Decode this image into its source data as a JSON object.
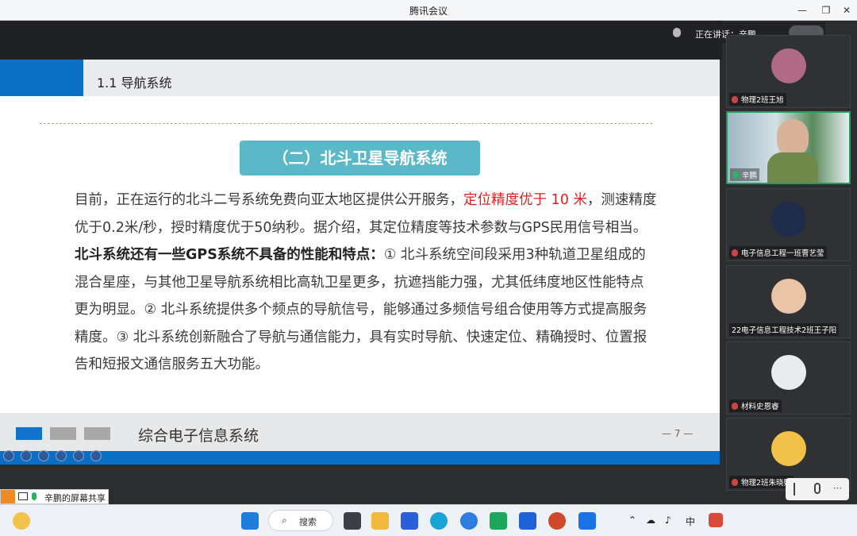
{
  "app": {
    "title": "腾讯会议"
  },
  "speaker": {
    "label": "正在讲话：辛鹏"
  },
  "slide": {
    "section_title": "1.1 导航系统",
    "badge": "（二）北斗卫星导航系统",
    "p1_a": "目前，正在运行的北斗二号系统免费向亚太地区提供公开服务，",
    "p1_red": "定位精度优于 10 米",
    "p1_b": "，测速精度优于0.2米/秒，授时精度优于50纳秒。据介绍，其定位精度等技术参数与GPS民用信号相当。",
    "p2_bold": "北斗系统还有一些GPS系统不具备的性能和特点：",
    "p2_rest": "① 北斗系统空间段采用3种轨道卫星组成的混合星座，与其他卫星导航系统相比高轨卫星更多，抗遮挡能力强，尤其低纬度地区性能特点更为明显。② 北斗系统提供多个频点的导航信号，能够通过多频信号组合使用等方式提高服务精度。③ 北斗系统创新融合了导航与通信能力，具有实时导航、快速定位、精确授时、位置报告和短报文通信服务五大功能。",
    "footer_title": "综合电子信息系统",
    "page": "— 7 —"
  },
  "participants": [
    {
      "name": "物理2班王旭",
      "avatar_color": "#b06a86"
    },
    {
      "name": "辛鹏",
      "avatar_color": "#c9d8e4"
    },
    {
      "name": "电子信息工程一班曹艺莹",
      "avatar_color": "#1f2b4a"
    },
    {
      "name": "22电子信息工程技术2班王子阳",
      "avatar_color": "#e9c4a6"
    },
    {
      "name": "材料史恩睿",
      "avatar_color": "#e8ecef"
    },
    {
      "name": "物理2班朱晓熙",
      "avatar_color": "#f1c14a"
    }
  ],
  "share": {
    "label": "辛鹏的屏幕共享"
  },
  "taskbar": {
    "search": "搜索",
    "ime": "中"
  }
}
